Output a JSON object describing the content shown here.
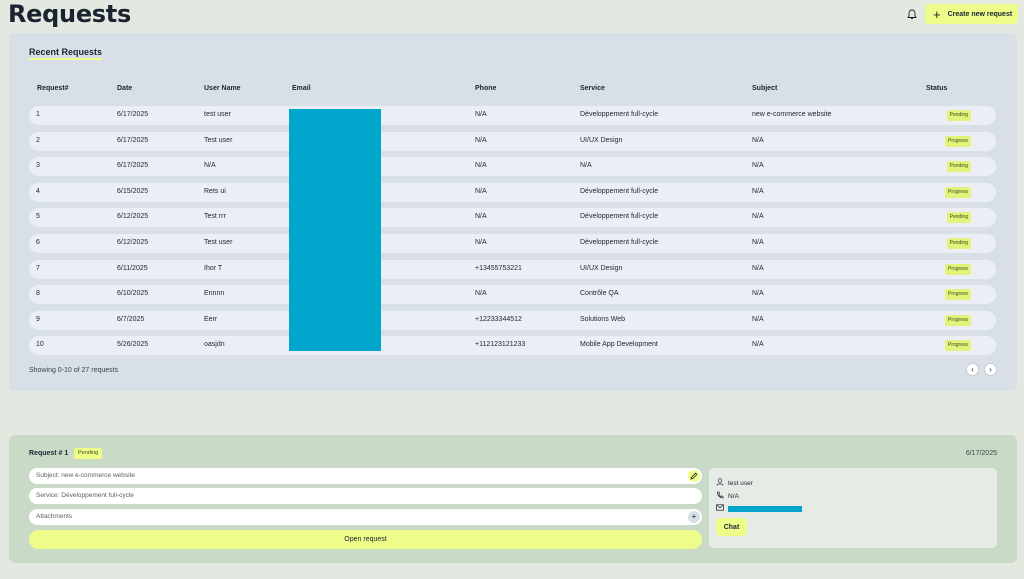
{
  "header": {
    "title": "Requests",
    "create_label": "Create new request",
    "bell_icon": "bell-icon",
    "plus_icon": "plus-icon"
  },
  "recent": {
    "title": "Recent Requests",
    "columns": [
      "Request#",
      "Date",
      "User Name",
      "Email",
      "Phone",
      "Service",
      "Subject",
      "Status"
    ],
    "rows": [
      {
        "id": "1",
        "date": "6/17/2025",
        "user": "test user",
        "phone": "N/A",
        "service": "Développement full-cycle",
        "subject": "new e-commerce website",
        "status": "Pending"
      },
      {
        "id": "2",
        "date": "6/17/2025",
        "user": "Test user",
        "phone": "N/A",
        "service": "UI/UX Design",
        "subject": "N/A",
        "status": "Progress"
      },
      {
        "id": "3",
        "date": "6/17/2025",
        "user": "N/A",
        "phone": "N/A",
        "service": "N/A",
        "subject": "N/A",
        "status": "Pending"
      },
      {
        "id": "4",
        "date": "6/15/2025",
        "user": "Rets ui",
        "phone": "N/A",
        "service": "Développement full-cycle",
        "subject": "N/A",
        "status": "Progress"
      },
      {
        "id": "5",
        "date": "6/12/2025",
        "user": "Test rrr",
        "phone": "N/A",
        "service": "Développement full-cycle",
        "subject": "N/A",
        "status": "Pending"
      },
      {
        "id": "6",
        "date": "6/12/2025",
        "user": "Test user",
        "phone": "N/A",
        "service": "Développement full-cycle",
        "subject": "N/A",
        "status": "Pending"
      },
      {
        "id": "7",
        "date": "6/11/2025",
        "user": "Ihor T",
        "phone": "+13455753221",
        "service": "UI/UX Design",
        "subject": "N/A",
        "status": "Progress"
      },
      {
        "id": "8",
        "date": "6/10/2025",
        "user": "Ennnn",
        "phone": "N/A",
        "service": "Contrôle QA",
        "subject": "N/A",
        "status": "Progress"
      },
      {
        "id": "9",
        "date": "6/7/2025",
        "user": "Eerr",
        "phone": "+12233344512",
        "service": "Solutions Web",
        "subject": "N/A",
        "status": "Progress"
      },
      {
        "id": "10",
        "date": "5/26/2025",
        "user": "oasjdn",
        "phone": "+112123121233",
        "service": "Mobile App Development",
        "subject": "N/A",
        "status": "Progress"
      }
    ],
    "showing": "Showing 0-10 of 27 requests",
    "prev_icon": "chevron-left-icon",
    "next_icon": "chevron-right-icon"
  },
  "detail": {
    "title": "Request # 1",
    "status": "Pending",
    "date": "6/17/2025",
    "subject_value": "Subject: new e-commerce website",
    "service_value": "Service: Développement full-cycle",
    "attachments_placeholder": "Attachments",
    "open_label": "Open request",
    "user": "test user",
    "phone": "N/A",
    "chat_label": "Chat"
  },
  "colors": {
    "accent": "#eefc8a",
    "redaction": "#00a6cc",
    "panel": "#d8dfe7",
    "detail_panel": "#c9dbc7"
  }
}
